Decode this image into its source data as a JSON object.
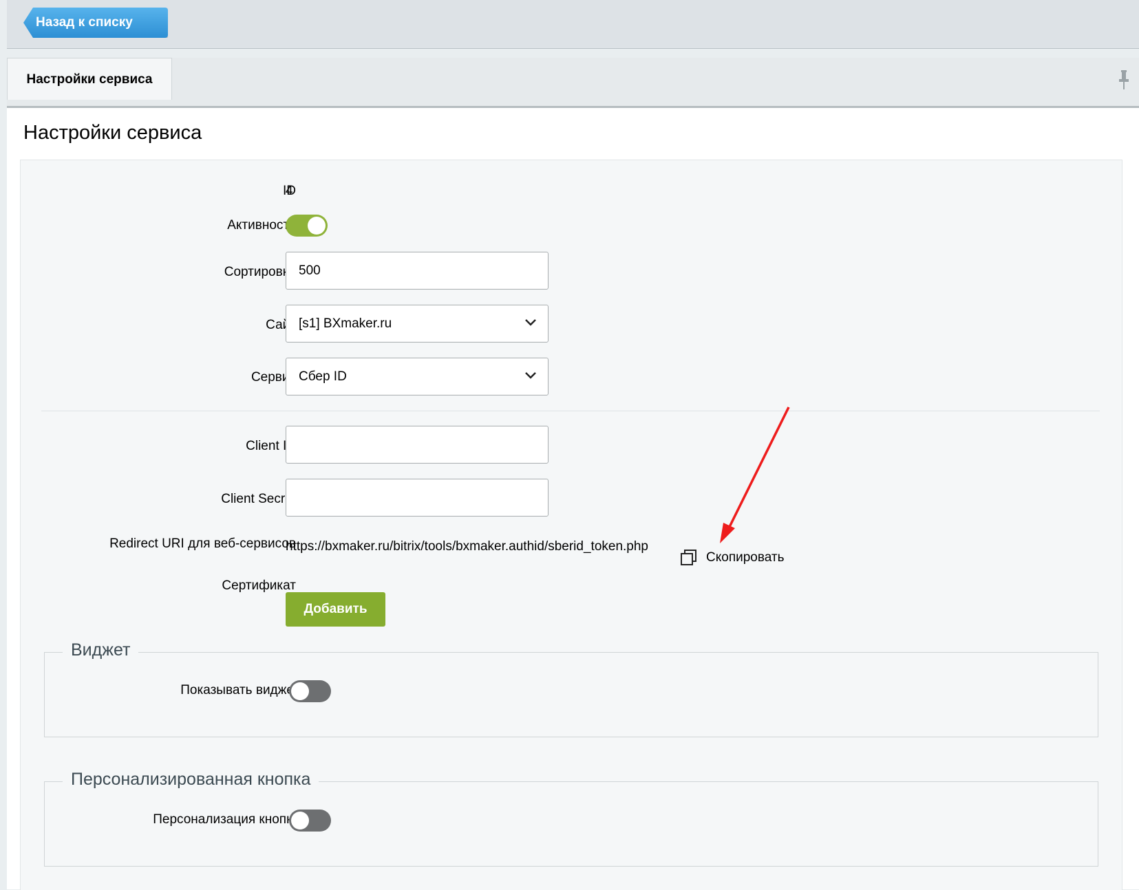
{
  "toolbar": {
    "back_label": "Назад к списку"
  },
  "tabs": [
    {
      "label": "Настройки сервиса"
    }
  ],
  "page": {
    "title": "Настройки сервиса"
  },
  "form": {
    "id": {
      "label": "ID",
      "value": "4"
    },
    "active": {
      "label": "Активность",
      "on": true
    },
    "sort": {
      "label": "Сортировка",
      "value": "500"
    },
    "site": {
      "label": "Сайт",
      "value": "[s1] BXmaker.ru"
    },
    "service": {
      "label": "Сервис",
      "value": "Сбер ID"
    },
    "client_id": {
      "label": "Client ID",
      "value": ""
    },
    "client_secret": {
      "label": "Client Secret",
      "value": ""
    },
    "redirect": {
      "label": "Redirect URI для веб-сервисов",
      "value": "https://bxmaker.ru/bitrix/tools/bxmaker.authid/sberid_token.php",
      "copy_label": "Скопировать"
    },
    "certificate": {
      "label": "Сертификат",
      "button_label": "Добавить"
    }
  },
  "widget": {
    "legend": "Виджет",
    "show": {
      "label": "Показывать виджет",
      "on": false
    }
  },
  "custom_button": {
    "legend": "Персонализированная кнопка",
    "personalize": {
      "label": "Персонализация кнопки",
      "on": false
    }
  },
  "colors": {
    "accent_blue": "#3a9ee0",
    "toggle_on": "#8fb33a",
    "toggle_off": "#6d6f71",
    "add_button": "#86ad2f",
    "annotation_arrow": "#ee1c1c"
  },
  "icons": {
    "pin": "pin-icon",
    "chevron": "chevron-down-icon",
    "copy": "copy-icon",
    "arrow": "annotation-arrow"
  }
}
